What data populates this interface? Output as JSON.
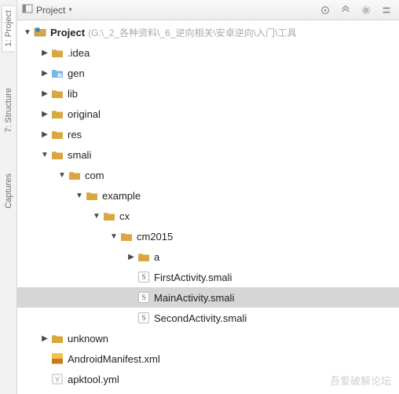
{
  "sidebar": {
    "tabs": [
      {
        "label": "1: Project"
      },
      {
        "label": "7: Structure"
      },
      {
        "label": "Captures"
      }
    ]
  },
  "toolbar": {
    "title_icon": "project-panel-icon",
    "title": "Project"
  },
  "tree": {
    "root": {
      "name": "Project",
      "path": "(G:\\_2_各种资料\\_6_逆向相关\\安卓逆向\\入门\\工具"
    },
    "nodes": [
      {
        "name": ".idea",
        "depth": 1,
        "expandable": true,
        "expanded": false,
        "icon": "folder"
      },
      {
        "name": "gen",
        "depth": 1,
        "expandable": true,
        "expanded": false,
        "icon": "gen-folder"
      },
      {
        "name": "lib",
        "depth": 1,
        "expandable": true,
        "expanded": false,
        "icon": "folder"
      },
      {
        "name": "original",
        "depth": 1,
        "expandable": true,
        "expanded": false,
        "icon": "folder"
      },
      {
        "name": "res",
        "depth": 1,
        "expandable": true,
        "expanded": false,
        "icon": "folder"
      },
      {
        "name": "smali",
        "depth": 1,
        "expandable": true,
        "expanded": true,
        "icon": "folder"
      },
      {
        "name": "com",
        "depth": 2,
        "expandable": true,
        "expanded": true,
        "icon": "folder"
      },
      {
        "name": "example",
        "depth": 3,
        "expandable": true,
        "expanded": true,
        "icon": "folder"
      },
      {
        "name": "cx",
        "depth": 4,
        "expandable": true,
        "expanded": true,
        "icon": "folder"
      },
      {
        "name": "cm2015",
        "depth": 5,
        "expandable": true,
        "expanded": true,
        "icon": "folder"
      },
      {
        "name": "a",
        "depth": 6,
        "expandable": true,
        "expanded": false,
        "icon": "folder"
      },
      {
        "name": "FirstActivity.smali",
        "depth": 6,
        "expandable": false,
        "icon": "smali"
      },
      {
        "name": "MainActivity.smali",
        "depth": 6,
        "expandable": false,
        "icon": "smali",
        "selected": true
      },
      {
        "name": "SecondActivity.smali",
        "depth": 6,
        "expandable": false,
        "icon": "smali"
      },
      {
        "name": "unknown",
        "depth": 1,
        "expandable": true,
        "expanded": false,
        "icon": "folder"
      },
      {
        "name": "AndroidManifest.xml",
        "depth": 1,
        "expandable": false,
        "icon": "xml"
      },
      {
        "name": "apktool.yml",
        "depth": 1,
        "expandable": false,
        "icon": "yml"
      }
    ]
  },
  "watermark": "吾爱破解论坛"
}
